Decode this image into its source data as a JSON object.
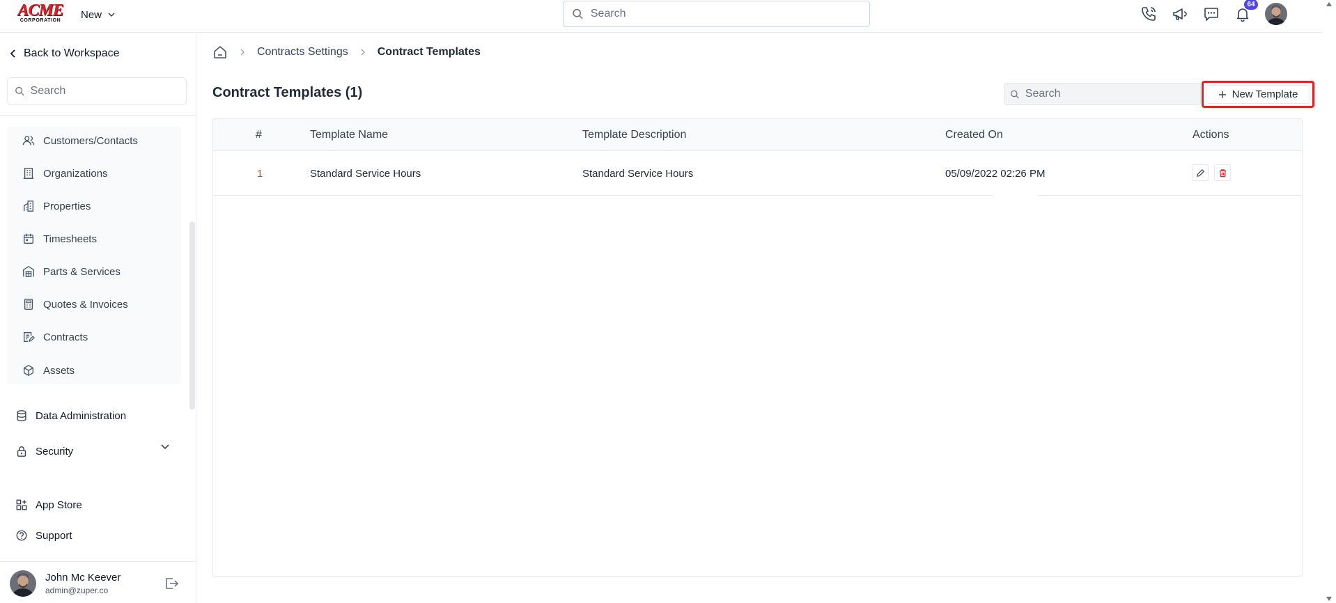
{
  "topbar": {
    "logo_main": "ACME",
    "logo_sub": "CORPORATION",
    "new_label": "New",
    "search_placeholder": "Search",
    "notification_count": "64"
  },
  "sidebar": {
    "back_label": "Back to Workspace",
    "search_placeholder": "Search",
    "items": [
      {
        "label": "Customers/Contacts",
        "icon": "users-icon"
      },
      {
        "label": "Organizations",
        "icon": "building-icon"
      },
      {
        "label": "Properties",
        "icon": "property-icon"
      },
      {
        "label": "Timesheets",
        "icon": "calendar-icon"
      },
      {
        "label": "Parts & Services",
        "icon": "warehouse-icon"
      },
      {
        "label": "Quotes & Invoices",
        "icon": "calculator-icon"
      },
      {
        "label": "Contracts",
        "icon": "contract-icon"
      },
      {
        "label": "Assets",
        "icon": "box-icon"
      }
    ],
    "data_admin": "Data Administration",
    "security": "Security",
    "app_store": "App Store",
    "support": "Support",
    "user_name": "John Mc Keever",
    "user_email": "admin@zuper.co"
  },
  "breadcrumb": {
    "parent": "Contracts Settings",
    "current": "Contract Templates"
  },
  "page": {
    "title": "Contract Templates (1)",
    "search_placeholder": "Search",
    "new_button": "New Template"
  },
  "table": {
    "headers": {
      "num": "#",
      "name": "Template Name",
      "description": "Template Description",
      "created": "Created On",
      "actions": "Actions"
    },
    "rows": [
      {
        "num": "1",
        "name": "Standard Service Hours",
        "description": "Standard Service Hours",
        "created": "05/09/2022 02:26 PM"
      }
    ]
  },
  "colors": {
    "brand_red": "#d7262b",
    "highlight_red": "#e02424",
    "badge": "#4f46e5",
    "delete_red": "#dc2626"
  }
}
